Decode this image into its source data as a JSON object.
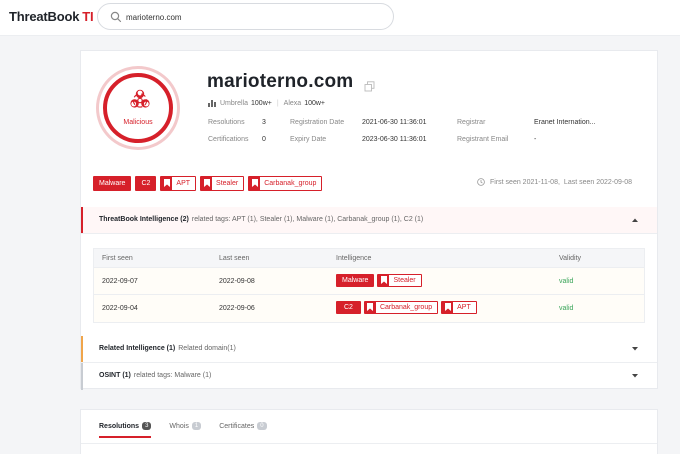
{
  "header": {
    "logo_text": "ThreatBook",
    "logo_suffix": "TI",
    "search_value": "marioterno.com"
  },
  "summary": {
    "badge_label": "Malicious",
    "domain": "marioterno.com",
    "umbrella_label": "Umbrella",
    "umbrella_value": "100w+",
    "alexa_label": "Alexa",
    "alexa_value": "100w+",
    "resolutions_label": "Resolutions",
    "resolutions_value": "3",
    "certificates_label": "Certifications",
    "certificates_value": "0",
    "reg_date_label": "Registration Date",
    "reg_date_value": "2021-06-30 11:36:01",
    "exp_date_label": "Expiry Date",
    "exp_date_value": "2023-06-30 11:36:01",
    "registrar_label": "Registrar",
    "registrar_value": "Eranet Internation...",
    "registrant_email_label": "Registrant Email",
    "registrant_email_value": "-",
    "tags": [
      {
        "label": "Malware",
        "style": "solid"
      },
      {
        "label": "C2",
        "style": "solid"
      },
      {
        "label": "APT",
        "style": "outline"
      },
      {
        "label": "Stealer",
        "style": "outline"
      },
      {
        "label": "Carbanak_group",
        "style": "outline"
      }
    ],
    "first_seen": "First seen 2021-11-08,",
    "last_seen": "Last seen 2022-09-08"
  },
  "intel_section": {
    "title": "ThreatBook Intelligence (2)",
    "related": "related tags: APT (1), Stealer (1), Malware (1), Carbanak_group (1), C2 (1)",
    "columns": [
      "First seen",
      "Last seen",
      "Intelligence",
      "Validity"
    ],
    "rows": [
      {
        "first_seen": "2022-09-07",
        "last_seen": "2022-09-08",
        "tag1": "Malware",
        "tag2": "Stealer",
        "validity": "valid"
      },
      {
        "first_seen": "2022-09-04",
        "last_seen": "2022-09-06",
        "tag1": "C2",
        "tag2": "Carbanak_group",
        "tag3": "APT",
        "validity": "valid"
      }
    ]
  },
  "related_section": {
    "title": "Related Intelligence (1)",
    "related": "Related domain(1)"
  },
  "osint_section": {
    "title": "OSINT (1)",
    "related": "related tags: Malware (1)"
  },
  "tabs": [
    {
      "label": "Resolutions",
      "count": "3"
    },
    {
      "label": "Whois",
      "count": "1"
    },
    {
      "label": "Certificates",
      "count": "0"
    }
  ],
  "colors": {
    "accent": "#d6202a",
    "valid": "#3aa55a",
    "related_bar": "#f0a54a"
  }
}
